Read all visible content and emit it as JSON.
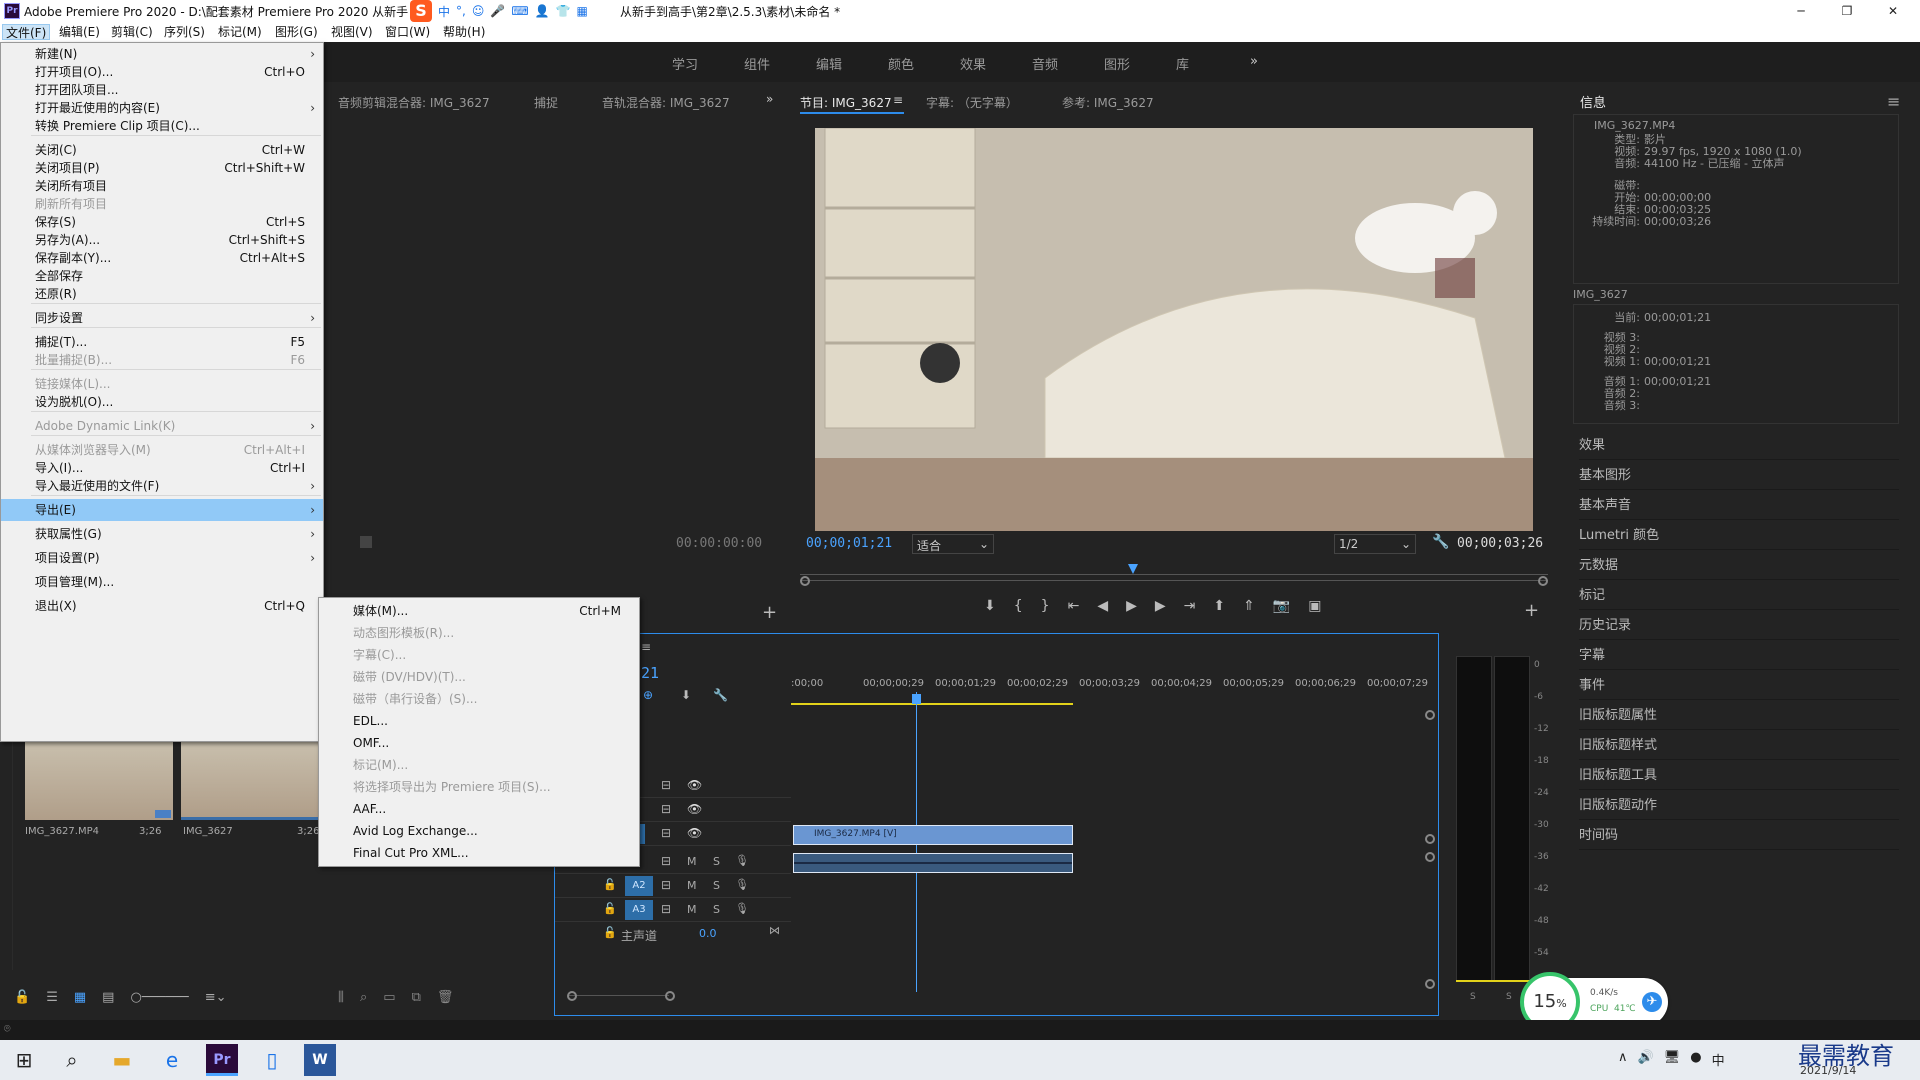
{
  "app": {
    "title_left": "Adobe Premiere Pro 2020 - D:\\配套素材 Premiere Pro 2020 从新手",
    "title_right": "从新手到高手\\第2章\\2.5.3\\素材\\未命名 *",
    "logo": "Pr"
  },
  "ime": {
    "brand": "S",
    "mode": "中",
    "punct": "°,"
  },
  "window_controls": [
    "─",
    "❐",
    "✕"
  ],
  "menubar": [
    "文件(F)",
    "编辑(E)",
    "剪辑(C)",
    "序列(S)",
    "标记(M)",
    "图形(G)",
    "视图(V)",
    "窗口(W)",
    "帮助(H)"
  ],
  "workspaces": [
    "学习",
    "组件",
    "编辑",
    "颜色",
    "效果",
    "音频",
    "图形",
    "库",
    "»"
  ],
  "source_panel": {
    "tabs": [
      "音频剪辑混合器: IMG_3627",
      "捕捉",
      "音轨混合器: IMG_3627",
      "»"
    ],
    "timecode": "00:00:00:00"
  },
  "program_panel": {
    "tabs": [
      "节目: IMG_3627",
      "字幕: （无字幕）",
      "参考: IMG_3627"
    ],
    "menu_icon": "≡",
    "current_tc": "00;00;01;21",
    "fit": "适合",
    "resolution": "1/2",
    "duration_tc": "00;00;03;26"
  },
  "file_menu": {
    "items": [
      {
        "label": "新建(N)",
        "shortcut": "",
        "arrow": "›",
        "disabled": false
      },
      {
        "label": "打开项目(O)...",
        "shortcut": "Ctrl+O",
        "arrow": "",
        "disabled": false
      },
      {
        "label": "打开团队项目...",
        "shortcut": "",
        "arrow": "",
        "disabled": false
      },
      {
        "label": "打开最近使用的内容(E)",
        "shortcut": "",
        "arrow": "›",
        "disabled": false
      },
      {
        "label": "转换 Premiere Clip 项目(C)...",
        "shortcut": "",
        "arrow": "",
        "disabled": false
      },
      {
        "label": "关闭(C)",
        "shortcut": "Ctrl+W",
        "arrow": "",
        "disabled": false
      },
      {
        "label": "关闭项目(P)",
        "shortcut": "Ctrl+Shift+W",
        "arrow": "",
        "disabled": false
      },
      {
        "label": "关闭所有项目",
        "shortcut": "",
        "arrow": "",
        "disabled": false
      },
      {
        "label": "刷新所有项目",
        "shortcut": "",
        "arrow": "",
        "disabled": true
      },
      {
        "label": "保存(S)",
        "shortcut": "Ctrl+S",
        "arrow": "",
        "disabled": false
      },
      {
        "label": "另存为(A)...",
        "shortcut": "Ctrl+Shift+S",
        "arrow": "",
        "disabled": false
      },
      {
        "label": "保存副本(Y)...",
        "shortcut": "Ctrl+Alt+S",
        "arrow": "",
        "disabled": false
      },
      {
        "label": "全部保存",
        "shortcut": "",
        "arrow": "",
        "disabled": false
      },
      {
        "label": "还原(R)",
        "shortcut": "",
        "arrow": "",
        "disabled": false
      },
      {
        "label": "同步设置",
        "shortcut": "",
        "arrow": "›",
        "disabled": false
      },
      {
        "label": "捕捉(T)...",
        "shortcut": "F5",
        "arrow": "",
        "disabled": false
      },
      {
        "label": "批量捕捉(B)...",
        "shortcut": "F6",
        "arrow": "",
        "disabled": true
      },
      {
        "label": "链接媒体(L)...",
        "shortcut": "",
        "arrow": "",
        "disabled": true
      },
      {
        "label": "设为脱机(O)...",
        "shortcut": "",
        "arrow": "",
        "disabled": false
      },
      {
        "label": "Adobe Dynamic Link(K)",
        "shortcut": "",
        "arrow": "›",
        "disabled": true
      },
      {
        "label": "从媒体浏览器导入(M)",
        "shortcut": "Ctrl+Alt+I",
        "arrow": "",
        "disabled": true
      },
      {
        "label": "导入(I)...",
        "shortcut": "Ctrl+I",
        "arrow": "",
        "disabled": false
      },
      {
        "label": "导入最近使用的文件(F)",
        "shortcut": "",
        "arrow": "›",
        "disabled": false
      },
      {
        "label": "导出(E)",
        "shortcut": "",
        "arrow": "›",
        "disabled": false,
        "highlight": true
      },
      {
        "label": "获取属性(G)",
        "shortcut": "",
        "arrow": "›",
        "disabled": false
      },
      {
        "label": "项目设置(P)",
        "shortcut": "",
        "arrow": "›",
        "disabled": false
      },
      {
        "label": "项目管理(M)...",
        "shortcut": "",
        "arrow": "",
        "disabled": false
      },
      {
        "label": "退出(X)",
        "shortcut": "Ctrl+Q",
        "arrow": "",
        "disabled": false
      }
    ]
  },
  "export_menu": {
    "items": [
      {
        "label": "媒体(M)...",
        "shortcut": "Ctrl+M",
        "disabled": false
      },
      {
        "label": "动态图形模板(R)...",
        "shortcut": "",
        "disabled": true
      },
      {
        "label": "字幕(C)...",
        "shortcut": "",
        "disabled": true
      },
      {
        "label": "磁带 (DV/HDV)(T)...",
        "shortcut": "",
        "disabled": true
      },
      {
        "label": "磁带（串行设备）(S)...",
        "shortcut": "",
        "disabled": true
      },
      {
        "label": "EDL...",
        "shortcut": "",
        "disabled": false
      },
      {
        "label": "OMF...",
        "shortcut": "",
        "disabled": false
      },
      {
        "label": "标记(M)...",
        "shortcut": "",
        "disabled": true
      },
      {
        "label": "将选择项导出为 Premiere 项目(S)...",
        "shortcut": "",
        "disabled": true
      },
      {
        "label": "AAF...",
        "shortcut": "",
        "disabled": false
      },
      {
        "label": "Avid Log Exchange...",
        "shortcut": "",
        "disabled": false
      },
      {
        "label": "Final Cut Pro XML...",
        "shortcut": "",
        "disabled": false
      }
    ]
  },
  "project_panel": {
    "items": [
      {
        "name": "IMG_3627.MP4",
        "duration": "3;26"
      },
      {
        "name": "IMG_3627",
        "duration": "3;26"
      }
    ]
  },
  "info_panel": {
    "title": "信息",
    "clip_name": "IMG_3627.MP4",
    "lines": [
      {
        "k": "类型:",
        "v": "影片"
      },
      {
        "k": "视频:",
        "v": "29.97 fps, 1920 x 1080 (1.0)"
      },
      {
        "k": "音频:",
        "v": "44100 Hz - 已压缩 - 立体声"
      },
      {
        "k": "磁带:",
        "v": ""
      },
      {
        "k": "开始:",
        "v": "00;00;00;00"
      },
      {
        "k": "结束:",
        "v": "00;00;03;25"
      },
      {
        "k": "持续时间:",
        "v": "00;00;03;26"
      }
    ],
    "seq_name": "IMG_3627",
    "seq_lines": [
      {
        "k": "当前:",
        "v": "00;00;01;21"
      },
      {
        "k": "视频 3:",
        "v": ""
      },
      {
        "k": "视频 2:",
        "v": ""
      },
      {
        "k": "视频 1:",
        "v": "00;00;01;21"
      },
      {
        "k": "音频 1:",
        "v": "00;00;01;21"
      },
      {
        "k": "音频 2:",
        "v": ""
      },
      {
        "k": "音频 3:",
        "v": ""
      }
    ],
    "panels": [
      "效果",
      "基本图形",
      "基本声音",
      "Lumetri 颜色",
      "元数据",
      "标记",
      "历史记录",
      "字幕",
      "事件",
      "旧版标题属性",
      "旧版标题样式",
      "旧版标题工具",
      "旧版标题动作",
      "时间码"
    ]
  },
  "timeline": {
    "tc_partial": "21",
    "ruler": [
      ":00;00",
      "00;00;00;29",
      "00;00;01;29",
      "00;00;02;29",
      "00;00;03;29",
      "00;00;04;29",
      "00;00;05;29",
      "00;00;06;29",
      "00;00;07;29"
    ],
    "video_clip": "IMG_3627.MP4 [V]",
    "audio_tracks": [
      "A2",
      "A3"
    ],
    "master": "主声道",
    "master_val": "0.0",
    "track_btn_m": "M",
    "track_btn_s": "S"
  },
  "meter": {
    "scale": [
      "0",
      "-6",
      "-12",
      "-18",
      "-24",
      "-30",
      "-36",
      "-42",
      "-48",
      "-54"
    ],
    "solo": [
      "S",
      "S"
    ]
  },
  "monitor_widget": {
    "cpu_pct": "15",
    "pct": "%",
    "net": "0.4K/s",
    "cpu_label": "CPU",
    "temp": "41℃"
  },
  "taskbar": {
    "date": "2021/9/14",
    "watermark": "最需教育",
    "tray": [
      "∧",
      "🔊",
      "中"
    ]
  }
}
